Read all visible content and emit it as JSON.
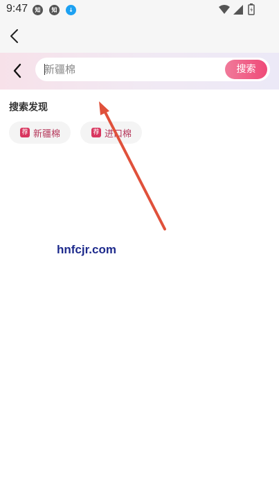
{
  "status_bar": {
    "time": "9:47",
    "notifications": [
      {
        "icon": "app-notification-icon",
        "glyph": "知"
      },
      {
        "icon": "app-notification-icon",
        "glyph": "知"
      },
      {
        "icon": "download-icon",
        "glyph": "↓"
      }
    ],
    "icons": [
      "wifi-icon",
      "signal-icon",
      "battery-icon"
    ]
  },
  "search": {
    "placeholder": "新疆棉",
    "button_label": "搜索"
  },
  "discover": {
    "title": "搜索发现",
    "chips": [
      {
        "badge": "荐",
        "label": "新疆棉"
      },
      {
        "badge": "荐",
        "label": "进口棉"
      }
    ]
  },
  "watermark": "hnfcjr.com",
  "colors": {
    "accent": "#ef4a78",
    "arrow": "#e0513b",
    "watermark": "#1d2a8c"
  }
}
